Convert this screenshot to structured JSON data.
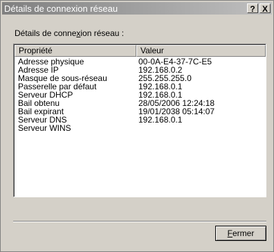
{
  "window": {
    "title": "Détails de connexion réseau",
    "help_label": "?",
    "close_label": "X"
  },
  "caption": {
    "before": "Détails de conne",
    "accel": "x",
    "after": "ion réseau :"
  },
  "list": {
    "columns": [
      "Propriété",
      "Valeur"
    ],
    "rows": [
      {
        "property": "Adresse physique",
        "value": "00-0A-E4-37-7C-E5"
      },
      {
        "property": "Adresse IP",
        "value": "192.168.0.2"
      },
      {
        "property": "Masque de sous-réseau",
        "value": "255.255.255.0"
      },
      {
        "property": "Passerelle par défaut",
        "value": "192.168.0.1"
      },
      {
        "property": "Serveur DHCP",
        "value": "192.168.0.1"
      },
      {
        "property": "Bail obtenu",
        "value": "28/05/2006 12:24:18"
      },
      {
        "property": "Bail expirant",
        "value": "19/01/2038 05:14:07"
      },
      {
        "property": "Serveur DNS",
        "value": "192.168.0.1"
      },
      {
        "property": "Serveur WINS",
        "value": ""
      }
    ]
  },
  "buttons": {
    "close_accel": "F",
    "close_rest": "ermer"
  }
}
